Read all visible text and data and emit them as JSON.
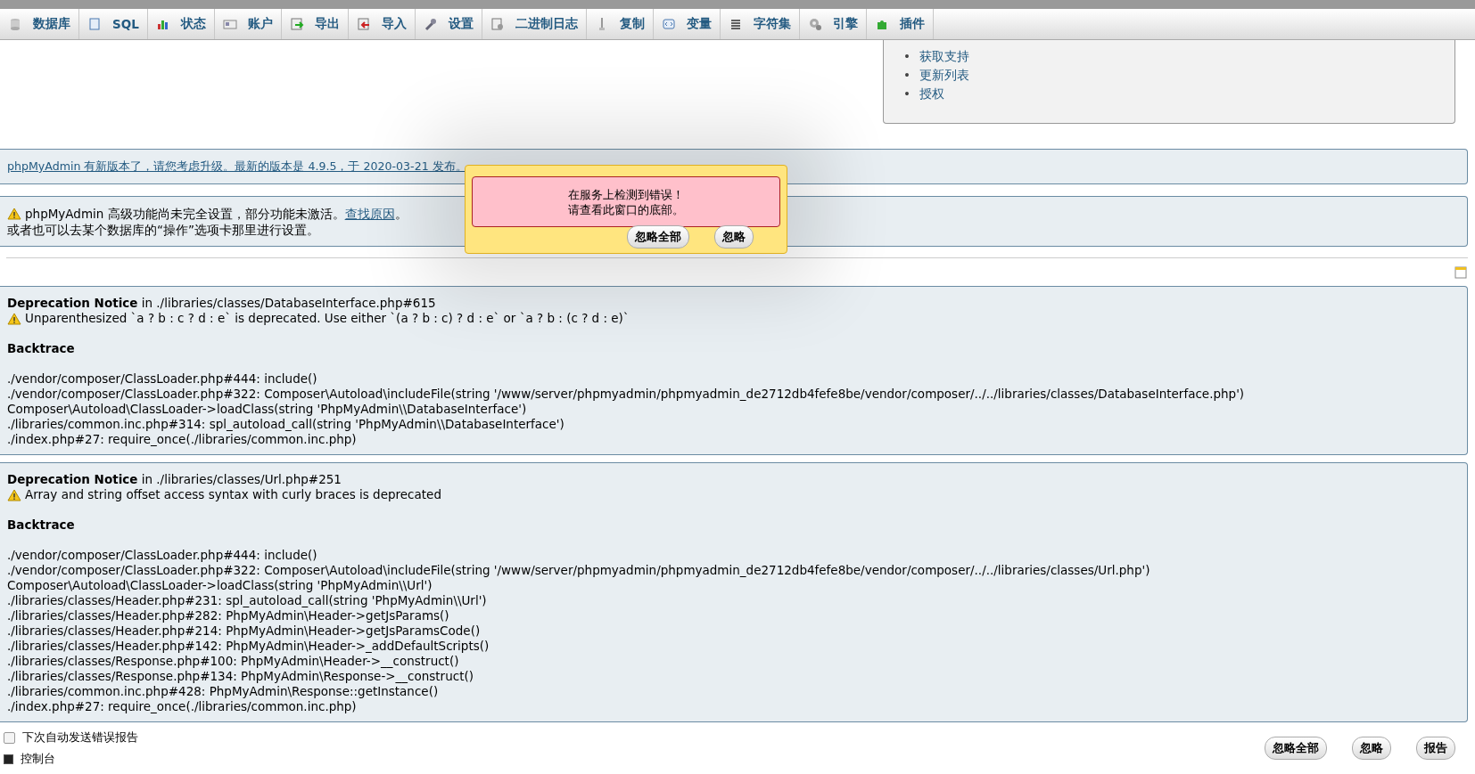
{
  "toolbar": {
    "tabs": [
      {
        "label": "数据库",
        "selected": false
      },
      {
        "label": "SQL",
        "selected": false
      },
      {
        "label": "状态",
        "selected": false
      },
      {
        "label": "账户",
        "selected": false
      },
      {
        "label": "导出",
        "selected": false
      },
      {
        "label": "导入",
        "selected": false
      },
      {
        "label": "设置",
        "selected": false
      },
      {
        "label": "二进制日志",
        "selected": false
      },
      {
        "label": "复制",
        "selected": false
      },
      {
        "label": "变量",
        "selected": false
      },
      {
        "label": "字符集",
        "selected": false
      },
      {
        "label": "引擎",
        "selected": false
      },
      {
        "label": "插件",
        "selected": false
      }
    ]
  },
  "links_panel": {
    "bullet": "•",
    "items": [
      "获取支持",
      "更新列表",
      "授权"
    ]
  },
  "update_notice": {
    "text": "phpMyAdmin 有新版本了，请您考虑升级。最新的版本是 4.9.5，于 2020-03-21 发布。"
  },
  "config_notice": {
    "text": "phpMyAdmin 高级功能尚未完全设置，部分功能未激活。",
    "link": "查找原因",
    "after": "。",
    "line2": "或者也可以去某个数据库的“操作”选项卡那里进行设置。"
  },
  "errors": [
    {
      "title": "Deprecation Notice",
      "location": "in ./libraries/classes/DatabaseInterface.php#615",
      "message": "Unparenthesized `a ? b : c ? d : e` is deprecated. Use either `(a ? b : c) ? d : e` or `a ? b : (c ? d : e)`",
      "backtrace_title": "Backtrace",
      "backtrace": [
        "./vendor/composer/ClassLoader.php#444: include()",
        "./vendor/composer/ClassLoader.php#322: Composer\\Autoload\\includeFile(string '/www/server/phpmyadmin/phpmyadmin_de2712db4fefe8be/vendor/composer/../../libraries/classes/DatabaseInterface.php')",
        "Composer\\Autoload\\ClassLoader->loadClass(string 'PhpMyAdmin\\\\DatabaseInterface')",
        "./libraries/common.inc.php#314: spl_autoload_call(string 'PhpMyAdmin\\\\DatabaseInterface')",
        "./index.php#27: require_once(./libraries/common.inc.php)"
      ]
    },
    {
      "title": "Deprecation Notice",
      "location": "in ./libraries/classes/Url.php#251",
      "message": "Array and string offset access syntax with curly braces is deprecated",
      "backtrace_title": "Backtrace",
      "backtrace": [
        "./vendor/composer/ClassLoader.php#444: include()",
        "./vendor/composer/ClassLoader.php#322: Composer\\Autoload\\includeFile(string '/www/server/phpmyadmin/phpmyadmin_de2712db4fefe8be/vendor/composer/../../libraries/classes/Url.php')",
        "Composer\\Autoload\\ClassLoader->loadClass(string 'PhpMyAdmin\\\\Url')",
        "./libraries/classes/Header.php#231: spl_autoload_call(string 'PhpMyAdmin\\\\Url')",
        "./libraries/classes/Header.php#282: PhpMyAdmin\\Header->getJsParams()",
        "./libraries/classes/Header.php#214: PhpMyAdmin\\Header->getJsParamsCode()",
        "./libraries/classes/Header.php#142: PhpMyAdmin\\Header->_addDefaultScripts()",
        "./libraries/classes/Response.php#100: PhpMyAdmin\\Header->__construct()",
        "./libraries/classes/Response.php#134: PhpMyAdmin\\Response->__construct()",
        "./libraries/common.inc.php#428: PhpMyAdmin\\Response::getInstance()",
        "./index.php#27: require_once(./libraries/common.inc.php)"
      ]
    }
  ],
  "footer": {
    "auto_send": {
      "label": "下次自动发送错误报告",
      "checked": false
    },
    "buttons": [
      "忽略全部",
      "忽略",
      "报告"
    ],
    "console": "控制台"
  },
  "popup": {
    "message": [
      "在服务上检测到错误！",
      "请查看此窗口的底部。"
    ],
    "buttons": [
      "忽略全部",
      "忽略"
    ]
  }
}
